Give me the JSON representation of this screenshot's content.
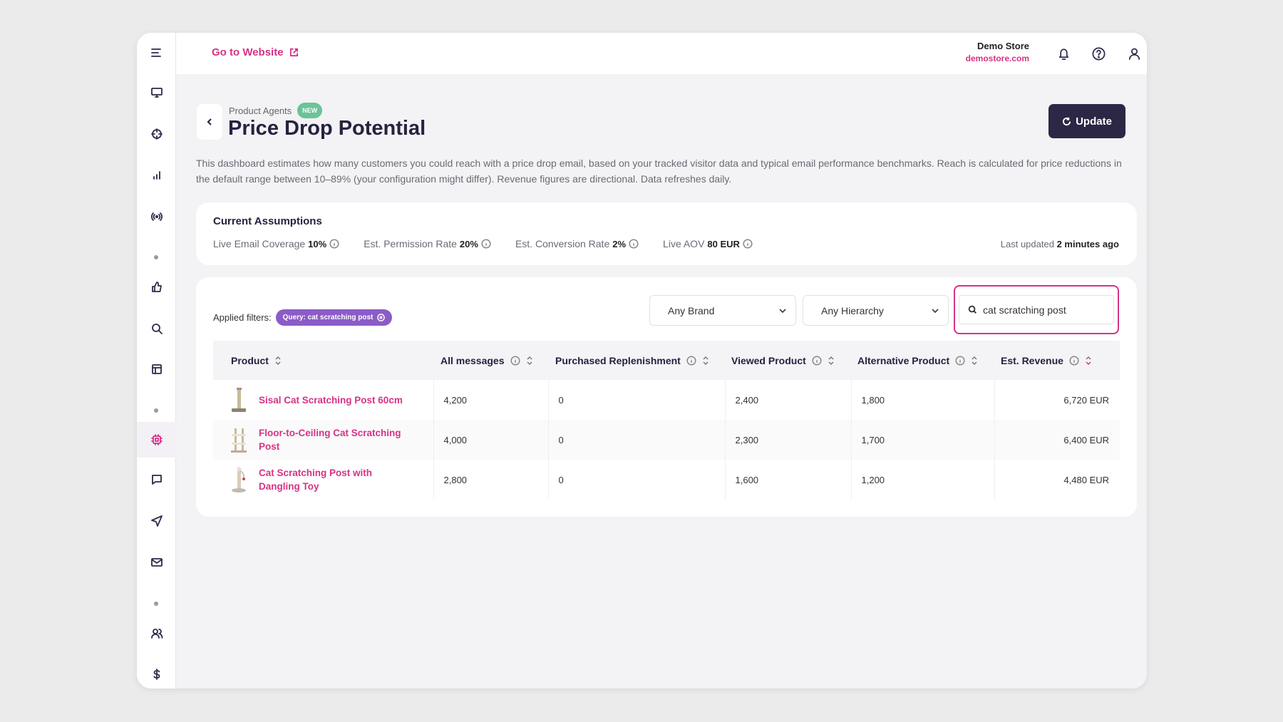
{
  "topbar": {
    "goto_label": "Go to Website",
    "store_name": "Demo Store",
    "store_url": "demostore.com"
  },
  "header": {
    "breadcrumb": "Product Agents",
    "badge": "NEW",
    "title": "Price Drop Potential",
    "update_label": "Update",
    "description": "This dashboard estimates how many customers you could reach with a price drop email, based on your tracked visitor data and typical email performance benchmarks. Reach is calculated for price reductions in the default range between 10–89% (your configuration might differ). Revenue figures are directional. Data refreshes daily."
  },
  "assumptions": {
    "title": "Current Assumptions",
    "items": [
      {
        "label": "Live Email Coverage",
        "value": "10%"
      },
      {
        "label": "Est. Permission Rate",
        "value": "20%"
      },
      {
        "label": "Est. Conversion Rate",
        "value": "2%"
      },
      {
        "label": "Live AOV",
        "value": "80 EUR"
      }
    ],
    "last_updated_label": "Last updated",
    "last_updated_value": "2 minutes ago"
  },
  "filters": {
    "applied_label": "Applied filters:",
    "chip_label": "Query: cat scratching post",
    "brand_select": "Any Brand",
    "hierarchy_select": "Any Hierarchy",
    "search_value": "cat scratching post"
  },
  "table": {
    "columns": [
      "Product",
      "All messages",
      "Purchased Replenishment",
      "Viewed Product",
      "Alternative Product",
      "Est. Revenue"
    ],
    "rows": [
      {
        "product": "Sisal Cat Scratching Post 60cm",
        "all": "4,200",
        "purchased": "0",
        "viewed": "2,400",
        "alternative": "1,800",
        "revenue": "6,720 EUR"
      },
      {
        "product": "Floor-to-Ceiling Cat Scratching Post",
        "all": "4,000",
        "purchased": "0",
        "viewed": "2,300",
        "alternative": "1,700",
        "revenue": "6,400 EUR"
      },
      {
        "product": "Cat Scratching Post with Dangling Toy",
        "all": "2,800",
        "purchased": "0",
        "viewed": "1,600",
        "alternative": "1,200",
        "revenue": "4,480 EUR"
      }
    ]
  },
  "colors": {
    "accent": "#d63384",
    "primary_dark": "#2b2745",
    "badge_green": "#6bc39a",
    "chip_purple": "#8b5cc7"
  }
}
